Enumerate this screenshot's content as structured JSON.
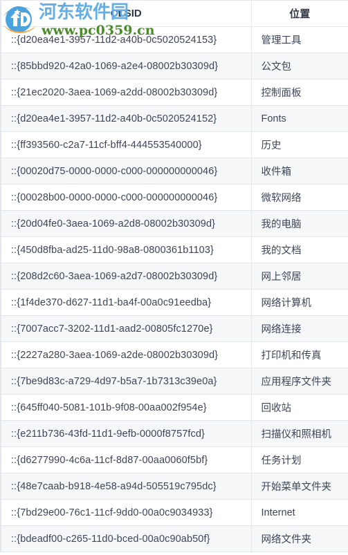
{
  "watermark": {
    "site_name": "河东软件园",
    "site_url": "www.pc0359.cn",
    "logo_icon": "circle-arrow-logo-icon",
    "name_color": "#63aee4",
    "url_color": "#4c8c2b",
    "logo_colors": {
      "blue": "#4ba3dd",
      "orange": "#f5a33c",
      "white": "#ffffff"
    }
  },
  "table": {
    "columns": [
      {
        "key": "clsid",
        "label": "CLSID"
      },
      {
        "key": "location",
        "label": "位置"
      }
    ],
    "rows": [
      {
        "clsid": "::{d20ea4e1-3957-11d2-a40b-0c5020524153}",
        "location": "管理工具"
      },
      {
        "clsid": "::{85bbd920-42a0-1069-a2e4-08002b30309d}",
        "location": "公文包"
      },
      {
        "clsid": "::{21ec2020-3aea-1069-a2dd-08002b30309d}",
        "location": "控制面板"
      },
      {
        "clsid": "::{d20ea4e1-3957-11d2-a40b-0c5020524152}",
        "location": "Fonts"
      },
      {
        "clsid": "::{ff393560-c2a7-11cf-bff4-444553540000}",
        "location": "历史"
      },
      {
        "clsid": "::{00020d75-0000-0000-c000-000000000046}",
        "location": "收件箱"
      },
      {
        "clsid": "::{00028b00-0000-0000-c000-000000000046}",
        "location": "微软网络"
      },
      {
        "clsid": "::{20d04fe0-3aea-1069-a2d8-08002b30309d}",
        "location": "我的电脑"
      },
      {
        "clsid": "::{450d8fba-ad25-11d0-98a8-0800361b1103}",
        "location": "我的文档"
      },
      {
        "clsid": "::{208d2c60-3aea-1069-a2d7-08002b30309d}",
        "location": "网上邻居"
      },
      {
        "clsid": "::{1f4de370-d627-11d1-ba4f-00a0c91eedba}",
        "location": "网络计算机"
      },
      {
        "clsid": "::{7007acc7-3202-11d1-aad2-00805fc1270e}",
        "location": "网络连接"
      },
      {
        "clsid": "::{2227a280-3aea-1069-a2de-08002b30309d}",
        "location": "打印机和传真"
      },
      {
        "clsid": "::{7be9d83c-a729-4d97-b5a7-1b7313c39e0a}",
        "location": "应用程序文件夹"
      },
      {
        "clsid": "::{645ff040-5081-101b-9f08-00aa002f954e}",
        "location": "回收站"
      },
      {
        "clsid": "::{e211b736-43fd-11d1-9efb-0000f8757fcd}",
        "location": "扫描仪和照相机"
      },
      {
        "clsid": "::{d6277990-4c6a-11cf-8d87-00aa0060f5bf}",
        "location": "任务计划"
      },
      {
        "clsid": "::{48e7caab-b918-4e58-a94d-505519c795dc}",
        "location": "开始菜单文件夹"
      },
      {
        "clsid": "::{7bd29e00-76c1-11cf-9dd0-00a0c9034933}",
        "location": "Internet"
      },
      {
        "clsid": "::{bdeadf00-c265-11d0-bced-00a0c90ab50f}",
        "location": "网络文件夹"
      }
    ]
  }
}
